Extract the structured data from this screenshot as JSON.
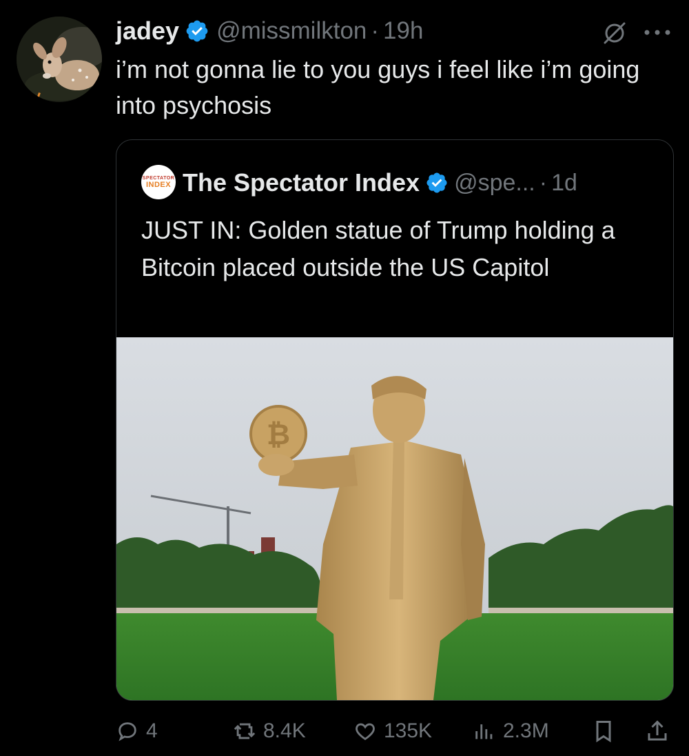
{
  "tweet": {
    "author_name": "jadey",
    "handle": "@missmilkton",
    "separator": "·",
    "time": "19h",
    "text": "i’m not gonna lie to you guys i feel like i’m going into psychosis"
  },
  "quote": {
    "avatar_line1": "SPECTATOR",
    "avatar_line2": "INDEX",
    "author_name": "The Spectator Index",
    "handle": "@spe...",
    "separator": "·",
    "time": "1d",
    "text": "JUST IN: Golden statue of Trump holding a Bitcoin placed outside the US Capitol"
  },
  "actions": {
    "replies": "4",
    "reposts": "8.4K",
    "likes": "135K",
    "views": "2.3M"
  },
  "icons": [
    "verified-icon",
    "grok-icon",
    "more-icon",
    "reply-icon",
    "repost-icon",
    "like-icon",
    "views-icon",
    "bookmark-icon",
    "share-icon"
  ],
  "colors": {
    "verified": "#1d9bf0",
    "muted": "#71767b",
    "text": "#e7e9ea",
    "background": "#000000"
  }
}
